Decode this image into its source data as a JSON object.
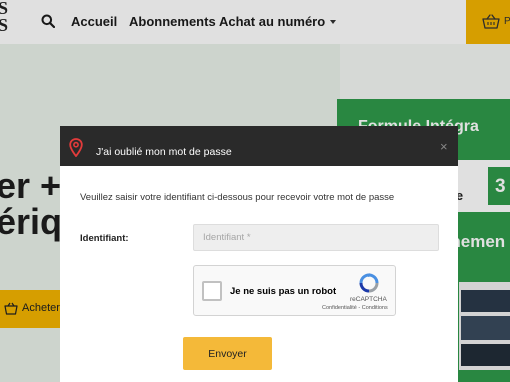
{
  "header": {
    "logo_text": "S\nS",
    "nav": {
      "search_icon": "search-icon",
      "home": "Accueil",
      "subscriptions": "Abonnements",
      "buy_issue": "Achat au numéro"
    },
    "cart": {
      "icon": "basket-icon",
      "label_partial": "P"
    },
    "accent_color": "#f4b400"
  },
  "hero": {
    "heading_line1": "er +",
    "heading_line2": "ériq",
    "buy_button_label": "Acheter"
  },
  "offer": {
    "title_partial": "Formule Intégra",
    "band_text_partial": "que",
    "price_partial": "3",
    "subtitle_partial": "nnemen",
    "brand_green": "#2f9a4a"
  },
  "modal": {
    "title": "J'ai oublié mon mot de passe",
    "close_label": "×",
    "intro": "Veuillez saisir votre identifiant ci-dessous pour recevoir votre mot de passe",
    "identifier_label": "Identifiant:",
    "identifier_value": "",
    "identifier_placeholder": "Identifiant *",
    "captcha": {
      "label": "Je ne suis pas un robot",
      "brand": "reCAPTCHA",
      "links": "Confidentialité - Conditions",
      "checked": false
    },
    "submit_label": "Envoyer",
    "pin_icon_color": "#e23b3b",
    "button_color": "#f4b939"
  }
}
